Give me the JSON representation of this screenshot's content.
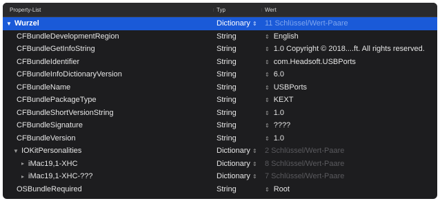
{
  "header": {
    "key": "Property-List",
    "type": "Typ",
    "value": "Wert"
  },
  "rows": [
    {
      "key": "Wurzel",
      "type": "Dictionary",
      "value": "11 Schlüssel/Wert-Paare"
    },
    {
      "key": "CFBundleDevelopmentRegion",
      "type": "String",
      "value": "English"
    },
    {
      "key": "CFBundleGetInfoString",
      "type": "String",
      "value": "1.0 Copyright © 2018....ft. All rights reserved."
    },
    {
      "key": "CFBundleIdentifier",
      "type": "String",
      "value": "com.Headsoft.USBPorts"
    },
    {
      "key": "CFBundleInfoDictionaryVersion",
      "type": "String",
      "value": "6.0"
    },
    {
      "key": "CFBundleName",
      "type": "String",
      "value": "USBPorts"
    },
    {
      "key": "CFBundlePackageType",
      "type": "String",
      "value": "KEXT"
    },
    {
      "key": "CFBundleShortVersionString",
      "type": "String",
      "value": "1.0"
    },
    {
      "key": "CFBundleSignature",
      "type": "String",
      "value": "????"
    },
    {
      "key": "CFBundleVersion",
      "type": "String",
      "value": "1.0"
    },
    {
      "key": "IOKitPersonalities",
      "type": "Dictionary",
      "value": "2 Schlüssel/Wert-Paare"
    },
    {
      "key": "iMac19,1-XHC",
      "type": "Dictionary",
      "value": "8 Schlüssel/Wert-Paare"
    },
    {
      "key": "iMac19,1-XHC-???",
      "type": "Dictionary",
      "value": "7 Schlüssel/Wert-Paare"
    },
    {
      "key": "OSBundleRequired",
      "type": "String",
      "value": "Root"
    }
  ],
  "icons": {
    "expanded": "chevron-down-icon",
    "collapsed": "chevron-right-icon",
    "stepper": "stepper-icon"
  },
  "colors": {
    "selection": "#1a5ad8",
    "background": "#1d1d1f",
    "text": "#e6e6e6",
    "dim": "#5a5a5e"
  }
}
